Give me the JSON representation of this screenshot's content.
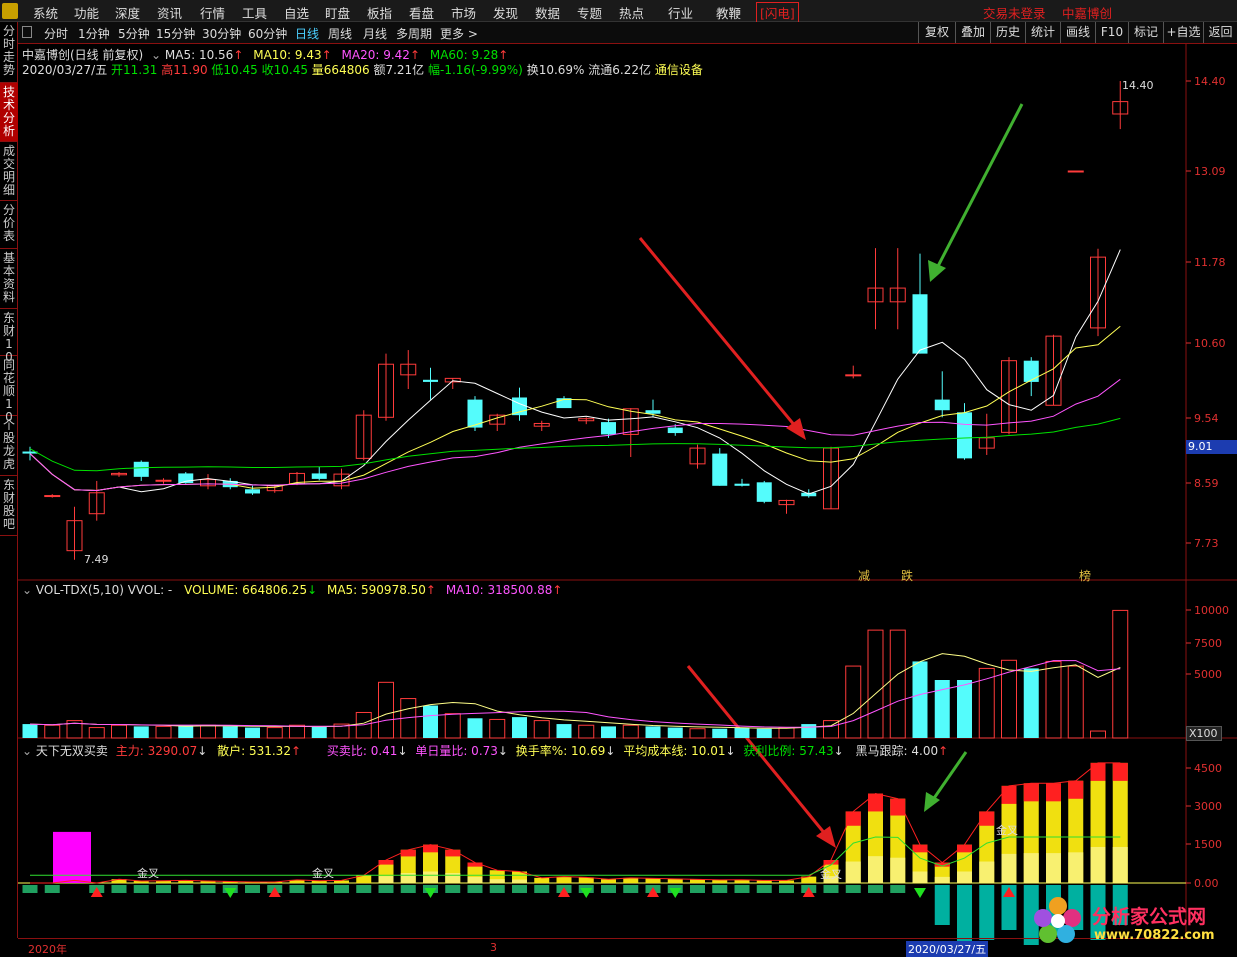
{
  "menubar": {
    "items": [
      "系统",
      "功能",
      "深度",
      "资讯",
      "行情",
      "工具",
      "自选",
      "盯盘",
      "板指",
      "看盘",
      "市场",
      "发现",
      "数据",
      "专题",
      "热点",
      "行业",
      "教鞭"
    ],
    "flash": "[闪电]",
    "login": "交易未登录",
    "title": "中嘉博创"
  },
  "timeframes": {
    "items": [
      "分时",
      "1分钟",
      "5分钟",
      "15分钟",
      "30分钟",
      "60分钟",
      "日线",
      "周线",
      "月线",
      "多周期",
      "更多 >"
    ],
    "selected": "日线"
  },
  "toolbar_buttons": [
    "复权",
    "叠加",
    "历史",
    "统计",
    "画线",
    "F10",
    "标记",
    "+自选",
    "返回"
  ],
  "sidebar": [
    "分时走势",
    "技术分析",
    "成交明细",
    "分价表",
    "基本资料",
    "东财10",
    "同花顺10",
    "个股龙虎",
    "东财股吧"
  ],
  "sidebar_active": "技术分析",
  "header": {
    "stock_title": "中嘉博创(日线 前复权)",
    "ma5": "MA5: 10.56",
    "ma10": "MA10: 9.43",
    "ma20": "MA20: 9.42",
    "ma60": "MA60: 9.28",
    "date": "2020/03/27/五",
    "open": "开11.31",
    "high": "高11.90",
    "low": "低10.45",
    "close": "收10.45",
    "volume": "量664806",
    "amount": "额7.21亿",
    "change": "幅-1.16(-9.99%)",
    "turnover": "换10.69%",
    "float_cap": "流通6.22亿",
    "industry": "通信设备"
  },
  "price_axis": [
    "14.40",
    "13.09",
    "11.78",
    "10.60",
    "9.54",
    "8.59",
    "7.73"
  ],
  "current_price": "9.01",
  "max_label": "14.40",
  "min_label": "7.49",
  "event_labels": [
    "减",
    "跌",
    "榜"
  ],
  "volume_panel": {
    "title": "VOL-TDX(5,10) VVOL: -",
    "volume": "VOLUME: 664806.25",
    "ma5": "MA5: 590978.50",
    "ma10": "MA10: 318500.88",
    "axis": [
      "10000",
      "7500",
      "5000"
    ],
    "unit": "X100"
  },
  "indicator_panel": {
    "title": "天下无双买卖",
    "main": "主力: 3290.07",
    "retail": "散户: 531.32",
    "buy_sell_ratio": "买卖比: 0.41",
    "daily_ratio": "单日量比: 0.73",
    "turnover": "换手率%: 10.69",
    "avg_cost": "平均成本线: 10.01",
    "profit_ratio": "获利比例: 57.43",
    "dark_horse": "黑马跟踪: 4.00",
    "axis": [
      "4500",
      "3000",
      "1500",
      "0.00"
    ],
    "golden_cross": "金叉"
  },
  "bottom": {
    "year": "2020年",
    "month": "3",
    "date": "2020/03/27/五"
  },
  "watermark": {
    "name": "分析家公式网",
    "url": "www.70822.com"
  },
  "colors": {
    "up": "#ff3b3b",
    "down": "#54fcfc",
    "ma5": "#ffffff",
    "ma10": "#ffff55",
    "ma20": "#ff55ff",
    "ma60": "#00e000",
    "axis": "#e03030",
    "border": "#8a1010"
  },
  "chart_data": {
    "type": "candlestick",
    "candles": [
      {
        "o": 9.05,
        "h": 9.12,
        "l": 8.92,
        "c": 9.02
      },
      {
        "o": 8.4,
        "h": 8.43,
        "l": 8.38,
        "c": 8.41
      },
      {
        "o": 7.62,
        "h": 8.25,
        "l": 7.49,
        "c": 8.05
      },
      {
        "o": 8.15,
        "h": 8.62,
        "l": 8.05,
        "c": 8.45
      },
      {
        "o": 8.71,
        "h": 8.75,
        "l": 8.68,
        "c": 8.73
      },
      {
        "o": 8.9,
        "h": 8.92,
        "l": 8.62,
        "c": 8.68
      },
      {
        "o": 8.62,
        "h": 8.66,
        "l": 8.58,
        "c": 8.63
      },
      {
        "o": 8.73,
        "h": 8.75,
        "l": 8.58,
        "c": 8.59
      },
      {
        "o": 8.55,
        "h": 8.72,
        "l": 8.5,
        "c": 8.64
      },
      {
        "o": 8.62,
        "h": 8.66,
        "l": 8.5,
        "c": 8.53
      },
      {
        "o": 8.5,
        "h": 8.55,
        "l": 8.42,
        "c": 8.44
      },
      {
        "o": 8.48,
        "h": 8.57,
        "l": 8.45,
        "c": 8.55
      },
      {
        "o": 8.58,
        "h": 8.75,
        "l": 8.56,
        "c": 8.73
      },
      {
        "o": 8.73,
        "h": 8.83,
        "l": 8.63,
        "c": 8.65
      },
      {
        "o": 8.55,
        "h": 8.8,
        "l": 8.5,
        "c": 8.72
      },
      {
        "o": 8.95,
        "h": 9.65,
        "l": 8.92,
        "c": 9.58
      },
      {
        "o": 9.55,
        "h": 10.45,
        "l": 9.5,
        "c": 10.3
      },
      {
        "o": 10.15,
        "h": 10.5,
        "l": 9.95,
        "c": 10.3
      },
      {
        "o": 10.08,
        "h": 10.25,
        "l": 9.8,
        "c": 10.05
      },
      {
        "o": 10.05,
        "h": 10.1,
        "l": 9.95,
        "c": 10.1
      },
      {
        "o": 9.8,
        "h": 9.85,
        "l": 9.35,
        "c": 9.4
      },
      {
        "o": 9.45,
        "h": 9.6,
        "l": 9.35,
        "c": 9.58
      },
      {
        "o": 9.83,
        "h": 9.97,
        "l": 9.5,
        "c": 9.58
      },
      {
        "o": 9.42,
        "h": 9.5,
        "l": 9.35,
        "c": 9.46
      },
      {
        "o": 9.82,
        "h": 9.85,
        "l": 9.7,
        "c": 9.68
      },
      {
        "o": 9.5,
        "h": 9.55,
        "l": 9.45,
        "c": 9.53
      },
      {
        "o": 9.48,
        "h": 9.53,
        "l": 9.25,
        "c": 9.3
      },
      {
        "o": 9.3,
        "h": 9.68,
        "l": 8.97,
        "c": 9.67
      },
      {
        "o": 9.65,
        "h": 9.8,
        "l": 9.55,
        "c": 9.6
      },
      {
        "o": 9.4,
        "h": 9.45,
        "l": 9.28,
        "c": 9.32
      },
      {
        "o": 8.87,
        "h": 9.15,
        "l": 8.8,
        "c": 9.1
      },
      {
        "o": 9.02,
        "h": 9.1,
        "l": 8.55,
        "c": 8.55
      },
      {
        "o": 8.58,
        "h": 8.65,
        "l": 8.54,
        "c": 8.55
      },
      {
        "o": 8.6,
        "h": 8.62,
        "l": 8.3,
        "c": 8.32
      },
      {
        "o": 8.28,
        "h": 8.35,
        "l": 8.15,
        "c": 8.34
      },
      {
        "o": 8.45,
        "h": 8.5,
        "l": 8.38,
        "c": 8.4
      },
      {
        "o": 8.22,
        "h": 9.12,
        "l": 8.22,
        "c": 9.1
      },
      {
        "o": 10.15,
        "h": 10.28,
        "l": 10.1,
        "c": 10.15
      },
      {
        "o": 11.2,
        "h": 11.98,
        "l": 10.8,
        "c": 11.4
      },
      {
        "o": 11.2,
        "h": 11.98,
        "l": 10.8,
        "c": 11.4
      },
      {
        "o": 11.31,
        "h": 11.9,
        "l": 10.45,
        "c": 10.45
      },
      {
        "o": 9.8,
        "h": 10.2,
        "l": 9.55,
        "c": 9.65
      },
      {
        "o": 9.62,
        "h": 9.75,
        "l": 8.93,
        "c": 8.95
      },
      {
        "o": 9.1,
        "h": 9.6,
        "l": 9.0,
        "c": 9.25
      },
      {
        "o": 9.33,
        "h": 10.4,
        "l": 9.3,
        "c": 10.35
      },
      {
        "o": 10.35,
        "h": 10.4,
        "l": 9.85,
        "c": 10.05
      },
      {
        "o": 9.72,
        "h": 10.72,
        "l": 9.72,
        "c": 10.7
      },
      {
        "o": 13.09,
        "h": 13.09,
        "l": 13.09,
        "c": 13.09
      },
      {
        "o": 10.82,
        "h": 11.97,
        "l": 10.7,
        "c": 11.85
      },
      {
        "o": 13.92,
        "h": 14.4,
        "l": 13.7,
        "c": 14.1
      }
    ],
    "volume": [
      1.2,
      1.1,
      1.5,
      0.9,
      1.1,
      1.0,
      1.0,
      1.1,
      1.1,
      1.0,
      0.9,
      0.9,
      1.1,
      1.0,
      1.2,
      2.2,
      4.8,
      3.4,
      2.8,
      2.1,
      1.7,
      1.6,
      1.8,
      1.5,
      1.2,
      1.1,
      1.0,
      1.1,
      1.0,
      0.9,
      0.8,
      0.8,
      0.9,
      0.8,
      0.9,
      1.2,
      1.5,
      6.2,
      9.3,
      9.3,
      6.6,
      5.0,
      5.0,
      6.0,
      6.7,
      6.0,
      6.6,
      6.2,
      0.6,
      11.0
    ],
    "volume_unit": "x100 (thousand shares axis 10000)",
    "indicator_main": [
      0,
      0,
      2000,
      0,
      150,
      80,
      90,
      100,
      80,
      60,
      40,
      40,
      120,
      90,
      100,
      300,
      900,
      1300,
      1500,
      1300,
      800,
      500,
      450,
      200,
      250,
      220,
      150,
      200,
      180,
      160,
      140,
      120,
      130,
      100,
      100,
      250,
      900,
      2800,
      3500,
      3300,
      1500,
      800,
      1500,
      2800,
      3800,
      3900,
      3900,
      4000,
      4700,
      4700
    ],
    "ylim_price": [
      7.3,
      14.9
    ],
    "ylim_volume": [
      0,
      11000
    ],
    "ylim_indicator": [
      -1800,
      5000
    ]
  }
}
